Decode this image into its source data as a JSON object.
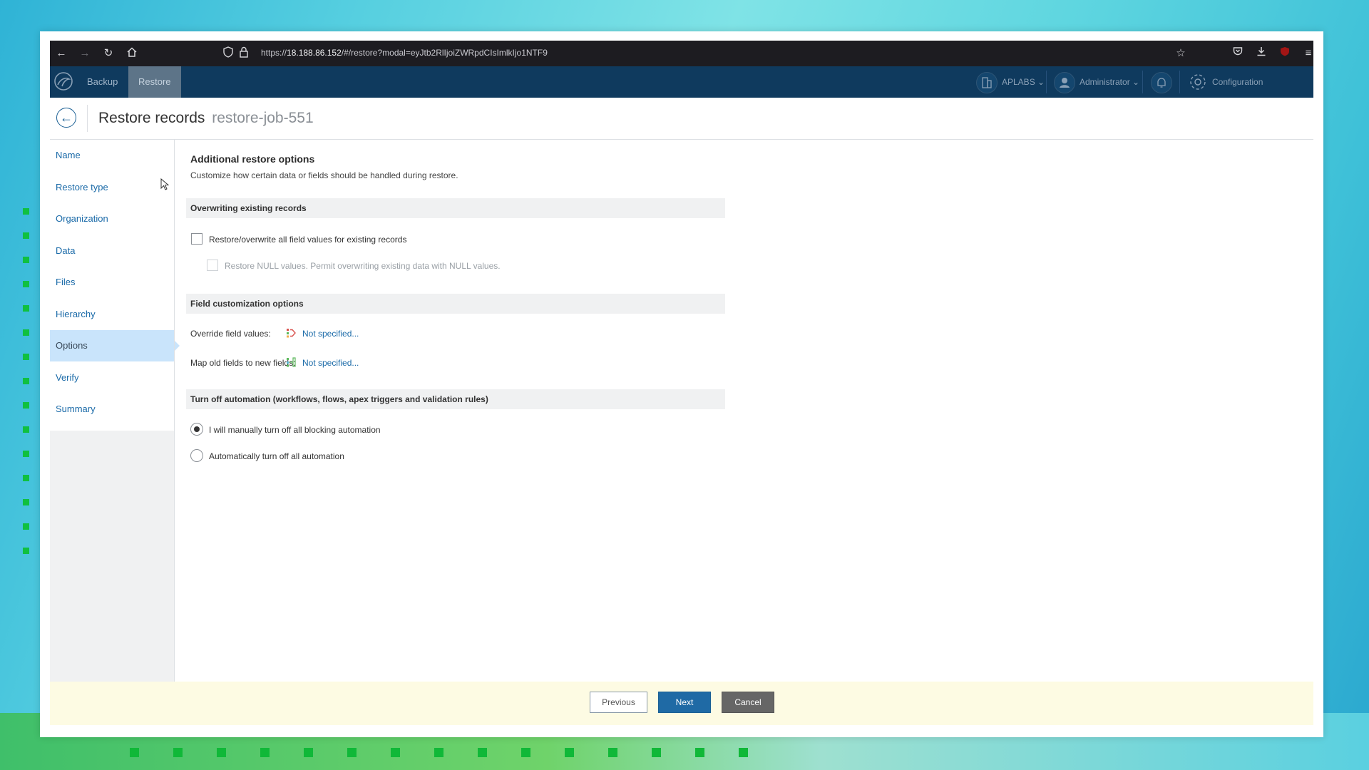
{
  "browser": {
    "url_prefix": "https://",
    "url_host": "18.188.86.152",
    "url_path": "/#/restore?modal=eyJtb2RlIjoiZWRpdCIsImlkIjo1NTF9"
  },
  "header": {
    "nav": [
      "Backup",
      "Restore"
    ],
    "active_nav": "Restore",
    "org": "APLABS",
    "user": "Administrator",
    "config": "Configuration"
  },
  "page": {
    "title": "Restore records",
    "subtitle": "restore-job-551"
  },
  "sidebar": {
    "items": [
      "Name",
      "Restore type",
      "Organization",
      "Data",
      "Files",
      "Hierarchy",
      "Options",
      "Verify",
      "Summary"
    ],
    "active": "Options"
  },
  "content": {
    "heading": "Additional restore options",
    "description": "Customize how certain data or fields should be handled during restore.",
    "overwrite_section": "Overwriting existing records",
    "overwrite_all": "Restore/overwrite all field values for existing records",
    "restore_null": "Restore NULL values. Permit overwriting existing data with NULL values.",
    "field_section": "Field customization options",
    "override_label": "Override field values:",
    "override_value": "Not specified...",
    "map_label": "Map old fields to new fields:",
    "map_value": "Not specified...",
    "automation_section": "Turn off automation (workflows, flows, apex triggers and validation rules)",
    "manual_option": "I will manually turn off all blocking automation",
    "auto_option": "Automatically turn off all automation"
  },
  "footer": {
    "previous": "Previous",
    "next": "Next",
    "cancel": "Cancel"
  },
  "colors": {
    "header_bg": "#0f3a5e",
    "link": "#1a6aa8",
    "active_sidebar": "#c9e4fb",
    "primary_button": "#1f6aa5",
    "footer_bg": "#fdfbe3"
  }
}
